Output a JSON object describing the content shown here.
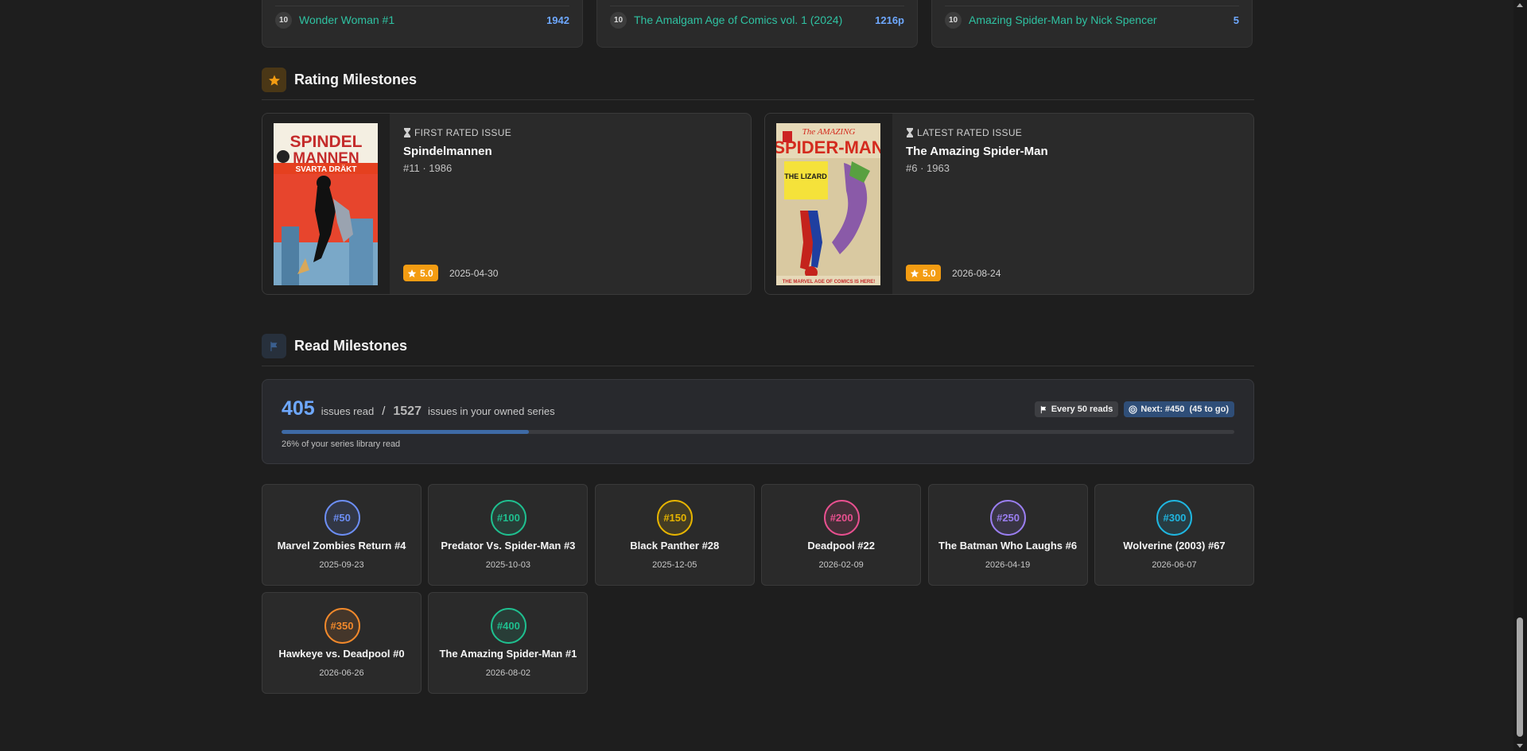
{
  "top_lists": [
    {
      "rank": "10",
      "name": "Wonder Woman #1",
      "value": "1942"
    },
    {
      "rank": "10",
      "name": "The Amalgam Age of Comics vol. 1 (2024)",
      "value": "1216p"
    },
    {
      "rank": "10",
      "name": "Amazing Spider-Man by Nick Spencer",
      "value": "5"
    }
  ],
  "rating_section": {
    "title": "Rating Milestones",
    "accent": "#f39c12",
    "cards": [
      {
        "kind": "FIRST RATED ISSUE",
        "series": "Spindelmannen",
        "meta": "#11 · 1986",
        "rating": "5.0",
        "date": "2025-04-30",
        "cover_title": "SPINDEL MANNEN",
        "cover_subtitle": "SVARTA DRÄKT"
      },
      {
        "kind": "LATEST RATED ISSUE",
        "series": "The Amazing Spider-Man",
        "meta": "#6 · 1963",
        "rating": "5.0",
        "date": "2026-08-24",
        "cover_title": "SPIDER-MAN",
        "cover_subtitle": "THE LIZARD"
      }
    ]
  },
  "read_section": {
    "title": "Read Milestones",
    "read_count": "405",
    "read_label": "issues read",
    "separator": "/",
    "owned_count": "1527",
    "owned_label": "issues in your owned series",
    "badge_every": "Every 50 reads",
    "badge_next": "Next: #450  (45 to go)",
    "progress_fraction": 0.26,
    "progress_text": "26% of your series library read"
  },
  "milestones": [
    {
      "number": "#50",
      "title": "Marvel Zombies Return #4",
      "date": "2025-09-23",
      "color": "#6c8ef5"
    },
    {
      "number": "#100",
      "title": "Predator Vs. Spider-Man #3",
      "date": "2025-10-03",
      "color": "#1fbf8f"
    },
    {
      "number": "#150",
      "title": "Black Panther #28",
      "date": "2025-12-05",
      "color": "#e6b400"
    },
    {
      "number": "#200",
      "title": "Deadpool #22",
      "date": "2026-02-09",
      "color": "#e8508f"
    },
    {
      "number": "#250",
      "title": "The Batman Who Laughs #6",
      "date": "2026-04-19",
      "color": "#9a7ef0"
    },
    {
      "number": "#300",
      "title": "Wolverine (2003) #67",
      "date": "2026-06-07",
      "color": "#1fb6e0"
    },
    {
      "number": "#350",
      "title": "Hawkeye vs. Deadpool #0",
      "date": "2026-06-26",
      "color": "#f2892b"
    },
    {
      "number": "#400",
      "title": "The Amazing Spider-Man #1",
      "date": "2026-08-02",
      "color": "#1fbf8f"
    }
  ]
}
